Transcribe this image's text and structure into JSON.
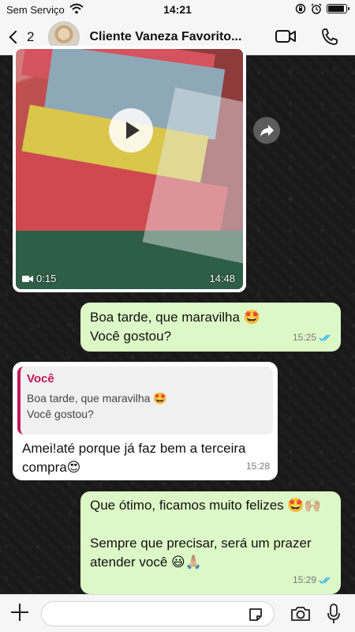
{
  "status_bar": {
    "carrier": "Sem Serviço",
    "time": "14:21"
  },
  "header": {
    "back_count": "2",
    "contact_name": "Cliente Vaneza Favorito...",
    "icons": [
      "back-chevron-icon",
      "video-call-icon",
      "phone-icon"
    ]
  },
  "messages": {
    "video": {
      "duration": "0:15",
      "time": "14:48"
    },
    "out1": {
      "text": "Boa tarde, que maravilha 🤩\nVocê gostou?",
      "time": "15:25",
      "status": "read"
    },
    "in1": {
      "quote_author": "Você",
      "quote_text": "Boa tarde, que maravilha 🤩\nVocê gostou?",
      "text": "Amei!até porque já faz bem a terceira compra😍",
      "time": "15:28"
    },
    "out2": {
      "text": "Que ótimo, ficamos muito felizes 🤩🙌🏼\n\nSempre que precisar, será um prazer atender você 😃🙏🏼",
      "time": "15:29",
      "status": "read"
    }
  },
  "colors": {
    "outgoing_bubble": "#dcf8c6",
    "incoming_bubble": "#ffffff",
    "read_ticks": "#34b7f1",
    "quote_accent": "#c2185b"
  },
  "input_bar": {
    "placeholder": "",
    "icons": [
      "plus-icon",
      "sticker-icon",
      "camera-icon",
      "mic-icon"
    ]
  }
}
